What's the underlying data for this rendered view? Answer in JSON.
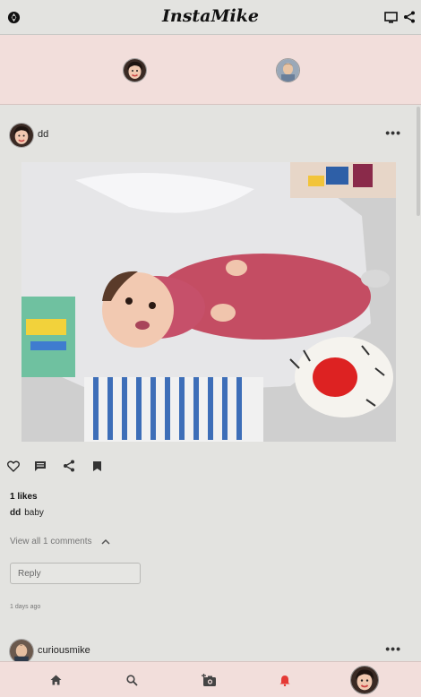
{
  "app": {
    "title": "InstaMike"
  },
  "header": {
    "left_icon": "aperture-icon",
    "right_icons": [
      "tv-icon",
      "share-icon"
    ]
  },
  "stories": [
    {
      "avatar": "woman-avatar"
    },
    {
      "avatar": "man-avatar"
    }
  ],
  "posts": [
    {
      "username": "dd",
      "image_description": "baby",
      "likes": "1 likes",
      "caption_user": "dd",
      "caption_text": "baby",
      "view_comments": "View all 1 comments",
      "reply_placeholder": "Reply",
      "timestamp": "1 days ago"
    },
    {
      "username": "curiousmike"
    }
  ],
  "bottom_nav": [
    "home-icon",
    "search-icon",
    "camera-add-icon",
    "bell-icon",
    "profile-avatar"
  ],
  "colors": {
    "background": "#e3e3e0",
    "accent_pink": "#f2dedb",
    "notification_red": "#e53935"
  }
}
